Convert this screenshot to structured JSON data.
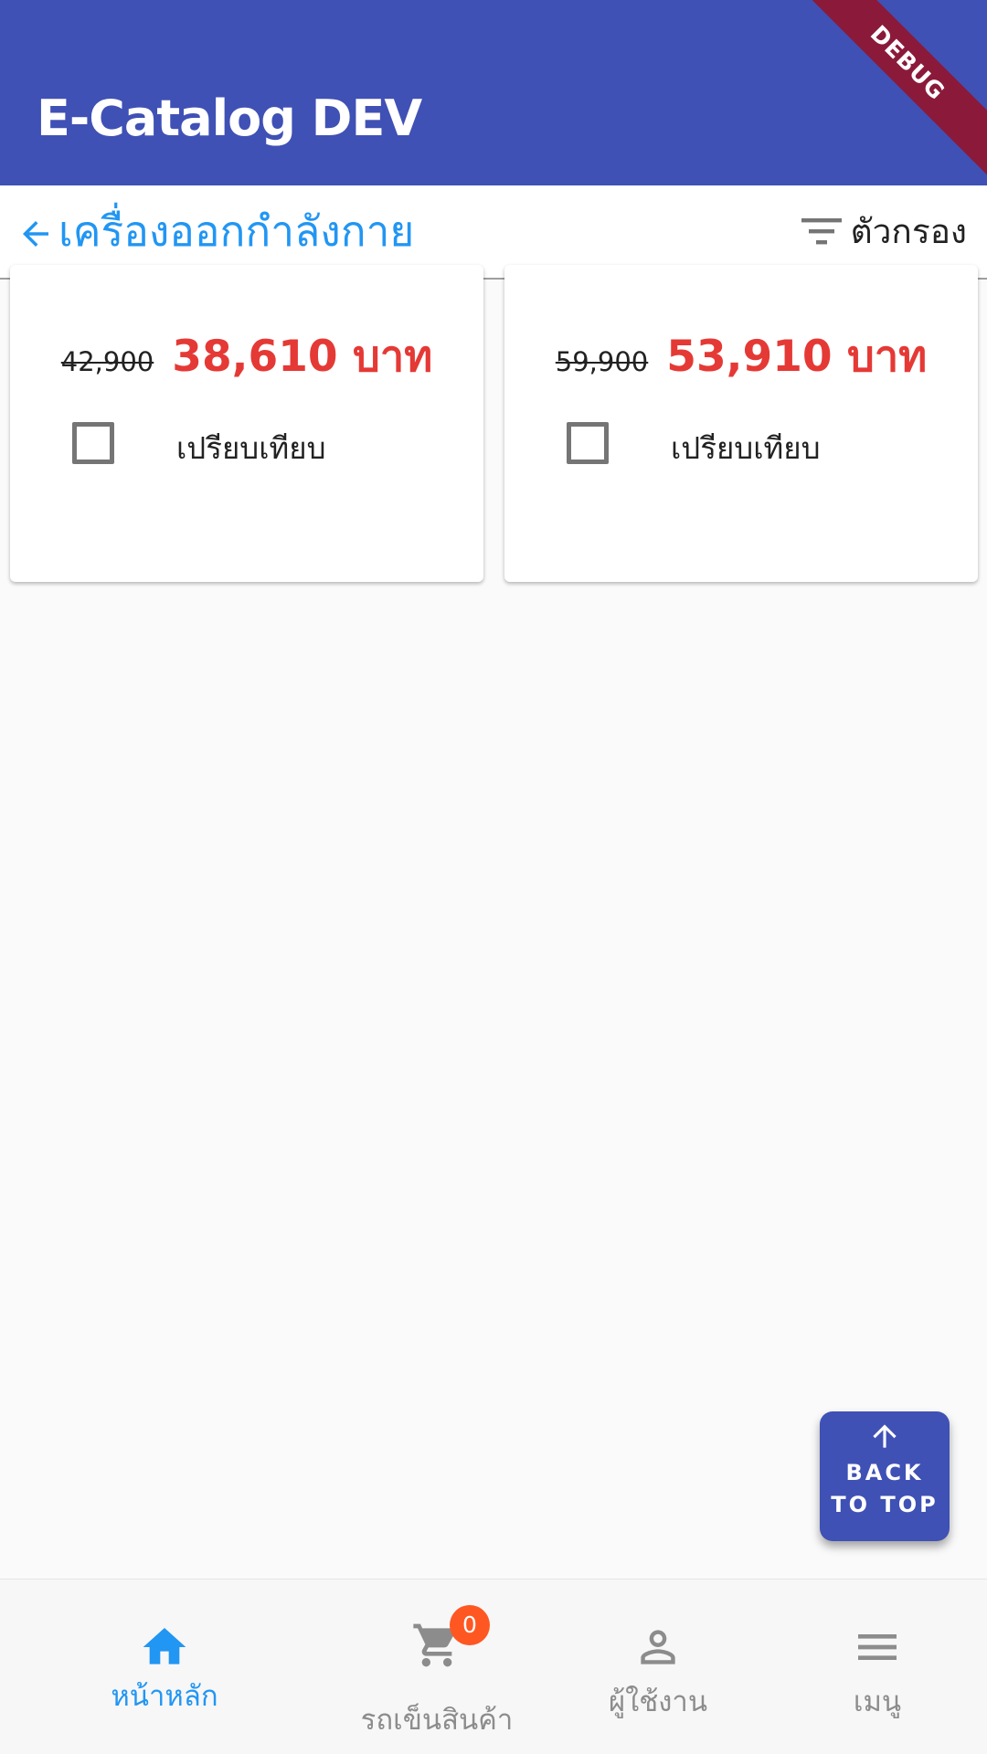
{
  "app_bar": {
    "title": "E-Catalog DEV",
    "debug_banner": "DEBUG",
    "color": "#3f51b5"
  },
  "category_bar": {
    "back_icon": "arrow-back-icon",
    "title": "เครื่องออกกำลังกาย",
    "filter_icon": "filter-list-icon",
    "filter_label": "ตัวกรอง"
  },
  "products": [
    {
      "old_price": "42,900",
      "new_price": "38,610 บาท",
      "compare_label": "เปรียบเทียบ",
      "compare_checked": false
    },
    {
      "old_price": "59,900",
      "new_price": "53,910 บาท",
      "compare_label": "เปรียบเทียบ",
      "compare_checked": false
    }
  ],
  "back_to_top": {
    "icon": "arrow-up-icon",
    "label": "BACK\nTO TOP"
  },
  "bottom_nav": {
    "items": [
      {
        "label": "หน้าหลัก",
        "icon": "home-icon",
        "active": true
      },
      {
        "label": "รถเข็นสินค้า",
        "icon": "cart-icon",
        "badge": "0"
      },
      {
        "label": "ผู้ใช้งาน",
        "icon": "person-icon"
      },
      {
        "label": "เมนู",
        "icon": "menu-icon"
      }
    ]
  },
  "colors": {
    "accent": "#2196f3",
    "price_red": "#e53935",
    "badge": "#ff5722"
  }
}
